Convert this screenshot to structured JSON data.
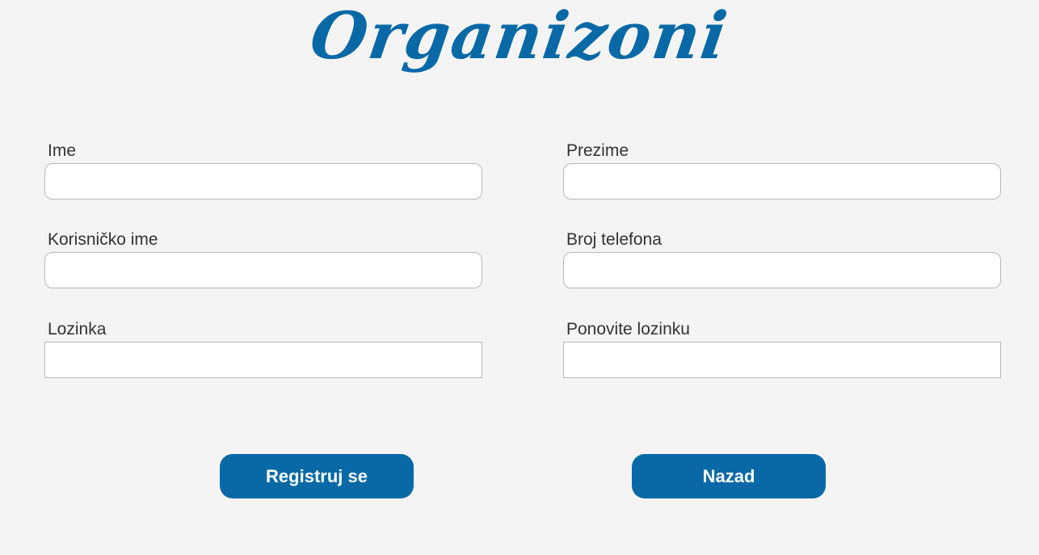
{
  "brand": {
    "logo_text": "Organizoni",
    "accent_color": "#0869a6"
  },
  "form": {
    "first_name": {
      "label": "Ime",
      "value": "",
      "placeholder": ""
    },
    "last_name": {
      "label": "Prezime",
      "value": "",
      "placeholder": ""
    },
    "username": {
      "label": "Korisničko ime",
      "value": "",
      "placeholder": ""
    },
    "phone": {
      "label": "Broj telefona",
      "value": "",
      "placeholder": ""
    },
    "password": {
      "label": "Lozinka",
      "value": "",
      "placeholder": ""
    },
    "password_repeat": {
      "label": "Ponovite lozinku",
      "value": "",
      "placeholder": ""
    }
  },
  "actions": {
    "register_label": "Registruj se",
    "back_label": "Nazad"
  }
}
